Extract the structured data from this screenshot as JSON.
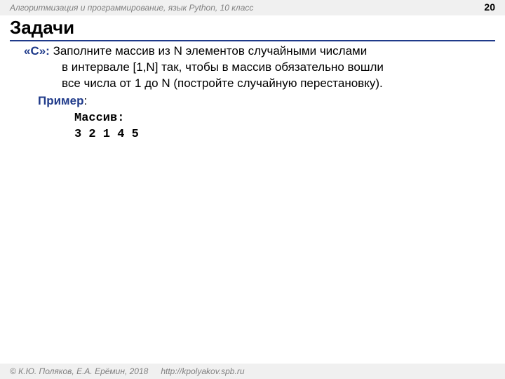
{
  "header": {
    "course": "Алгоритмизация и программирование, язык Python, 10 класс",
    "page": "20"
  },
  "title": "Задачи",
  "problem": {
    "tag": "«C»: ",
    "line1": "Заполните массив из N элементов случайными числами",
    "line2": "в интервале [1,N] так, чтобы в массив обязательно вошли",
    "line3": "все числа от 1 до N (постройте случайную перестановку).",
    "example_label": "Пример",
    "example": {
      "line1": "Массив:",
      "line2": "3 2 1 4 5"
    }
  },
  "footer": {
    "copyright": "© К.Ю. Поляков, Е.А. Ерёмин, 2018",
    "url": "http://kpolyakov.spb.ru"
  }
}
